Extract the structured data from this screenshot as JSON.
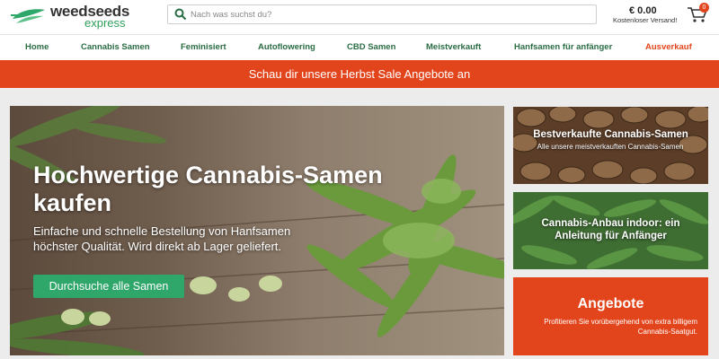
{
  "header": {
    "logo_main": "weedseeds",
    "logo_sub": "express",
    "search_placeholder": "Nach was suchst du?",
    "cart_total": "€ 0.00",
    "shipping": "Kostenloser Versand!",
    "cart_count": "0",
    "icons": [
      "logo-leaf-icon",
      "search-icon",
      "cart-icon"
    ]
  },
  "nav": {
    "items": [
      {
        "label": "Home"
      },
      {
        "label": "Cannabis Samen"
      },
      {
        "label": "Feminisiert"
      },
      {
        "label": "Autoflowering"
      },
      {
        "label": "CBD Samen"
      },
      {
        "label": "Meistverkauft"
      },
      {
        "label": "Hanfsamen für anfänger"
      },
      {
        "label": "Ausverkauf"
      }
    ]
  },
  "banner": {
    "text": "Schau dir unsere Herbst Sale Angebote an"
  },
  "hero": {
    "title": "Hochwertige Cannabis-Samen kaufen",
    "text": "Einfache und schnelle Bestellung von Hanfsamen höchster Qualität. Wird direkt ab Lager geliefert.",
    "button": "Durchsuche alle Samen"
  },
  "cards": [
    {
      "title": "Bestverkaufte Cannabis-Samen",
      "subtitle": "Alle unsere meistverkauften Cannabis-Samen"
    },
    {
      "title": "Cannabis-Anbau indoor: ein Anleitung für Anfänger",
      "subtitle": ""
    },
    {
      "title": "Angebote",
      "subtitle": "Profitieren Sie vorübergehend von extra billigem Cannabis-Saatgut."
    }
  ],
  "colors": {
    "accent": "#e2451c",
    "brand_green": "#2fa66a",
    "nav_text": "#2a6c43"
  }
}
